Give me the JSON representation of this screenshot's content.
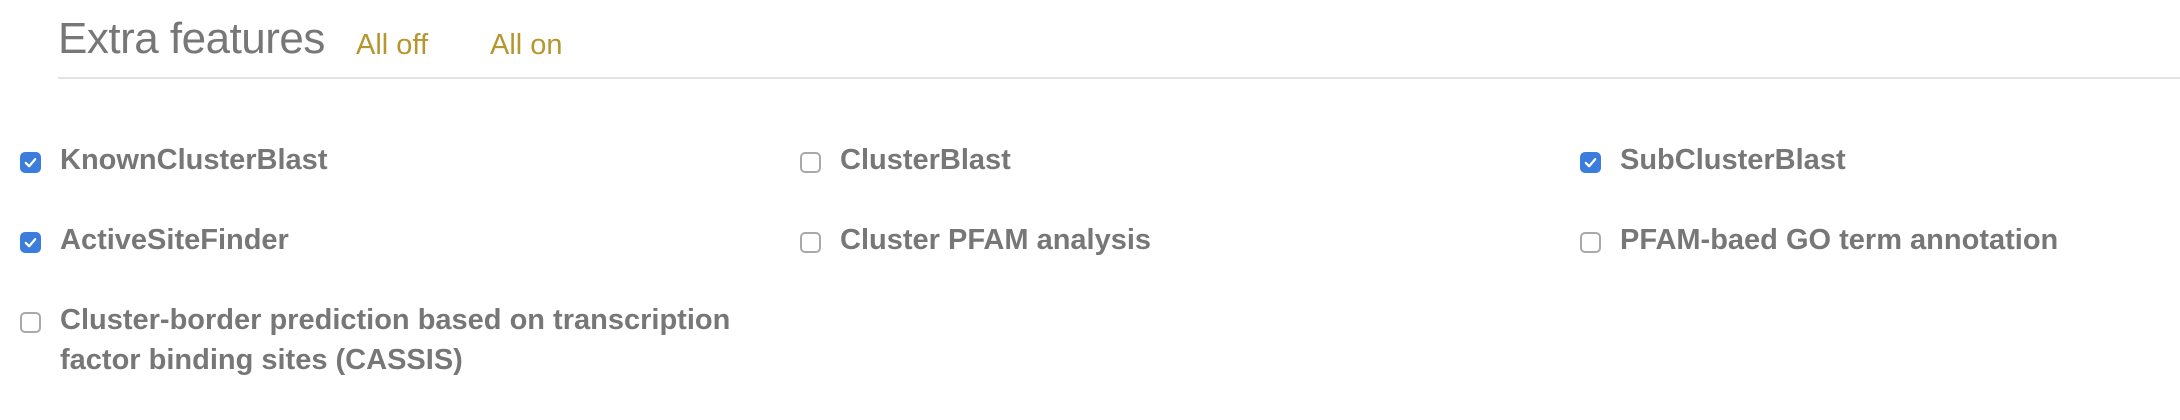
{
  "header": {
    "title": "Extra features",
    "all_off_label": "All off",
    "all_on_label": "All on"
  },
  "colors": {
    "link": "#b6962e",
    "text": "#777777",
    "checkbox_checked": "#3b7ddd"
  },
  "features": [
    {
      "label": "KnownClusterBlast",
      "checked": true
    },
    {
      "label": "ClusterBlast",
      "checked": false
    },
    {
      "label": "SubClusterBlast",
      "checked": true
    },
    {
      "label": "ActiveSiteFinder",
      "checked": true
    },
    {
      "label": "Cluster PFAM analysis",
      "checked": false
    },
    {
      "label": "PFAM-baed GO term annotation",
      "checked": false
    },
    {
      "label": "Cluster-border prediction based on transcription factor binding sites (CASSIS)",
      "checked": false
    }
  ]
}
